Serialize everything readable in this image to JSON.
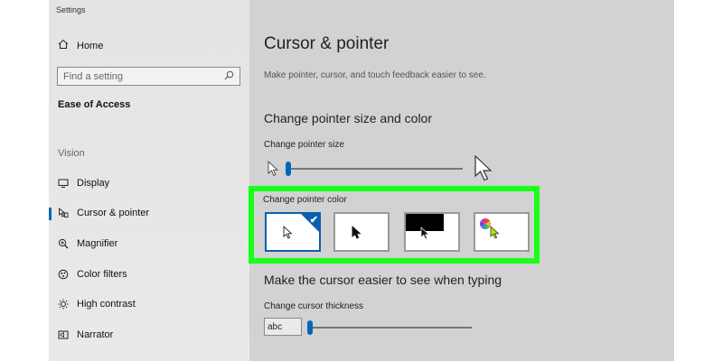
{
  "app": {
    "title": "Settings"
  },
  "sidebar": {
    "home_label": "Home",
    "search_placeholder": "Find a setting",
    "current_section": "Ease of Access",
    "group_label": "Vision",
    "items": [
      {
        "label": "Display",
        "icon": "display-icon"
      },
      {
        "label": "Cursor & pointer",
        "icon": "cursor-pointer-icon",
        "active": true
      },
      {
        "label": "Magnifier",
        "icon": "magnifier-icon"
      },
      {
        "label": "Color filters",
        "icon": "color-filters-icon"
      },
      {
        "label": "High contrast",
        "icon": "high-contrast-icon"
      },
      {
        "label": "Narrator",
        "icon": "narrator-icon"
      }
    ]
  },
  "main": {
    "title": "Cursor & pointer",
    "description": "Make pointer, cursor, and touch feedback easier to see.",
    "pointer_section": {
      "heading": "Change pointer size and color",
      "size_label": "Change pointer size",
      "size_level": 0.0,
      "color_label": "Change pointer color",
      "color_options": [
        {
          "name": "white",
          "selected": true
        },
        {
          "name": "black",
          "selected": false
        },
        {
          "name": "inverted",
          "selected": false
        },
        {
          "name": "custom",
          "selected": false
        }
      ]
    },
    "cursor_section": {
      "heading": "Make the cursor easier to see when typing",
      "thickness_label": "Change cursor thickness",
      "preview_text": "abc",
      "thickness_level": 0.0
    }
  },
  "colors": {
    "accent": "#0067b8",
    "highlight": "#19ff19",
    "sidebar_bg": "#e6e6e6",
    "main_bg": "#d2d2d2"
  }
}
